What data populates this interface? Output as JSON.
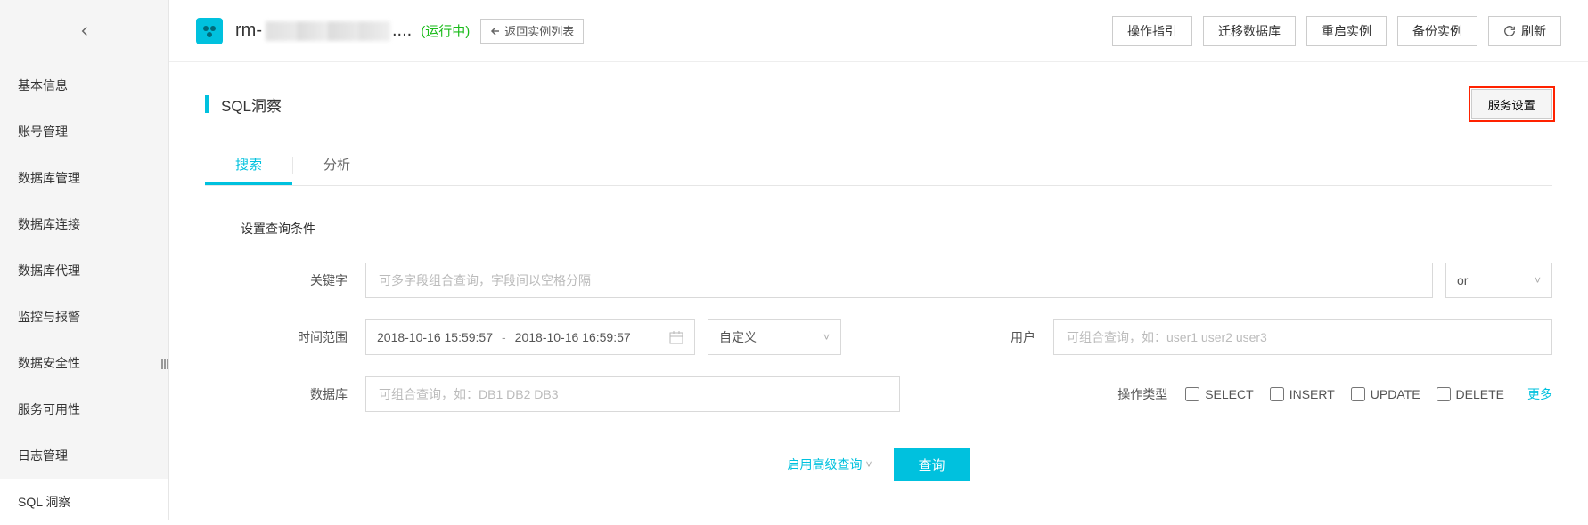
{
  "sidebar": {
    "items": [
      {
        "label": "基本信息"
      },
      {
        "label": "账号管理"
      },
      {
        "label": "数据库管理"
      },
      {
        "label": "数据库连接"
      },
      {
        "label": "数据库代理"
      },
      {
        "label": "监控与报警"
      },
      {
        "label": "数据安全性"
      },
      {
        "label": "服务可用性"
      },
      {
        "label": "日志管理"
      },
      {
        "label": "SQL 洞察"
      }
    ]
  },
  "header": {
    "title_prefix": "rm-",
    "ellipsis": "....",
    "status": "(运行中)",
    "return_list": "返回实例列表",
    "actions": {
      "guide": "操作指引",
      "migrate": "迁移数据库",
      "restart": "重启实例",
      "backup": "备份实例",
      "refresh": "刷新"
    }
  },
  "page": {
    "title": "SQL洞察",
    "service_settings": "服务设置"
  },
  "tabs": {
    "search": "搜索",
    "analyze": "分析"
  },
  "form": {
    "section_label": "设置查询条件",
    "keyword": {
      "label": "关键字",
      "placeholder": "可多字段组合查询，字段间以空格分隔"
    },
    "logic": {
      "value": "or"
    },
    "time": {
      "label": "时间范围",
      "from": "2018-10-16 15:59:57",
      "to": "2018-10-16 16:59:57",
      "preset": "自定义"
    },
    "user": {
      "label": "用户",
      "placeholder": "可组合查询，如：user1 user2 user3"
    },
    "database": {
      "label": "数据库",
      "placeholder": "可组合查询，如：DB1 DB2 DB3"
    },
    "optype": {
      "label": "操作类型",
      "options": {
        "select": "SELECT",
        "insert": "INSERT",
        "update": "UPDATE",
        "delete": "DELETE"
      },
      "more": "更多"
    },
    "adv": "启用高级查询",
    "query": "查询"
  }
}
